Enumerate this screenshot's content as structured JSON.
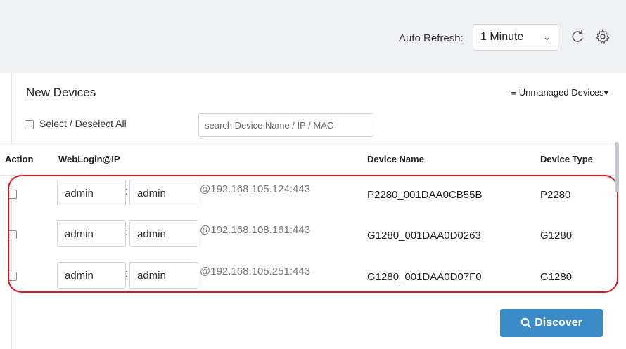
{
  "toolbar": {
    "auto_refresh_label": "Auto Refresh:",
    "auto_refresh_value": "1 Minute",
    "refresh_icon": "refresh-icon",
    "settings_icon": "gear-icon"
  },
  "panel": {
    "title": "New Devices",
    "unmanaged_menu": "≡ Unmanaged Devices▾",
    "select_all_label": "Select / Deselect All",
    "search_placeholder": "search Device Name / IP / MAC"
  },
  "table": {
    "columns": {
      "action": "Action",
      "weblogin": "WebLogin@IP",
      "device_name": "Device Name",
      "device_type": "Device Type"
    },
    "rows": [
      {
        "user": "admin",
        "pass": "admin",
        "ip": "@192.168.105.124:443",
        "name": "P2280_001DAA0CB55B",
        "type": "P2280"
      },
      {
        "user": "admin",
        "pass": "admin",
        "ip": "@192.168.108.161:443",
        "name": "G1280_001DAA0D0263",
        "type": "G1280"
      },
      {
        "user": "admin",
        "pass": "admin",
        "ip": "@192.168.105.251:443",
        "name": "G1280_001DAA0D07F0",
        "type": "G1280"
      }
    ]
  },
  "discover_button": "Discover",
  "colors": {
    "accent": "#3b8bc7",
    "highlight": "#e0141c"
  }
}
